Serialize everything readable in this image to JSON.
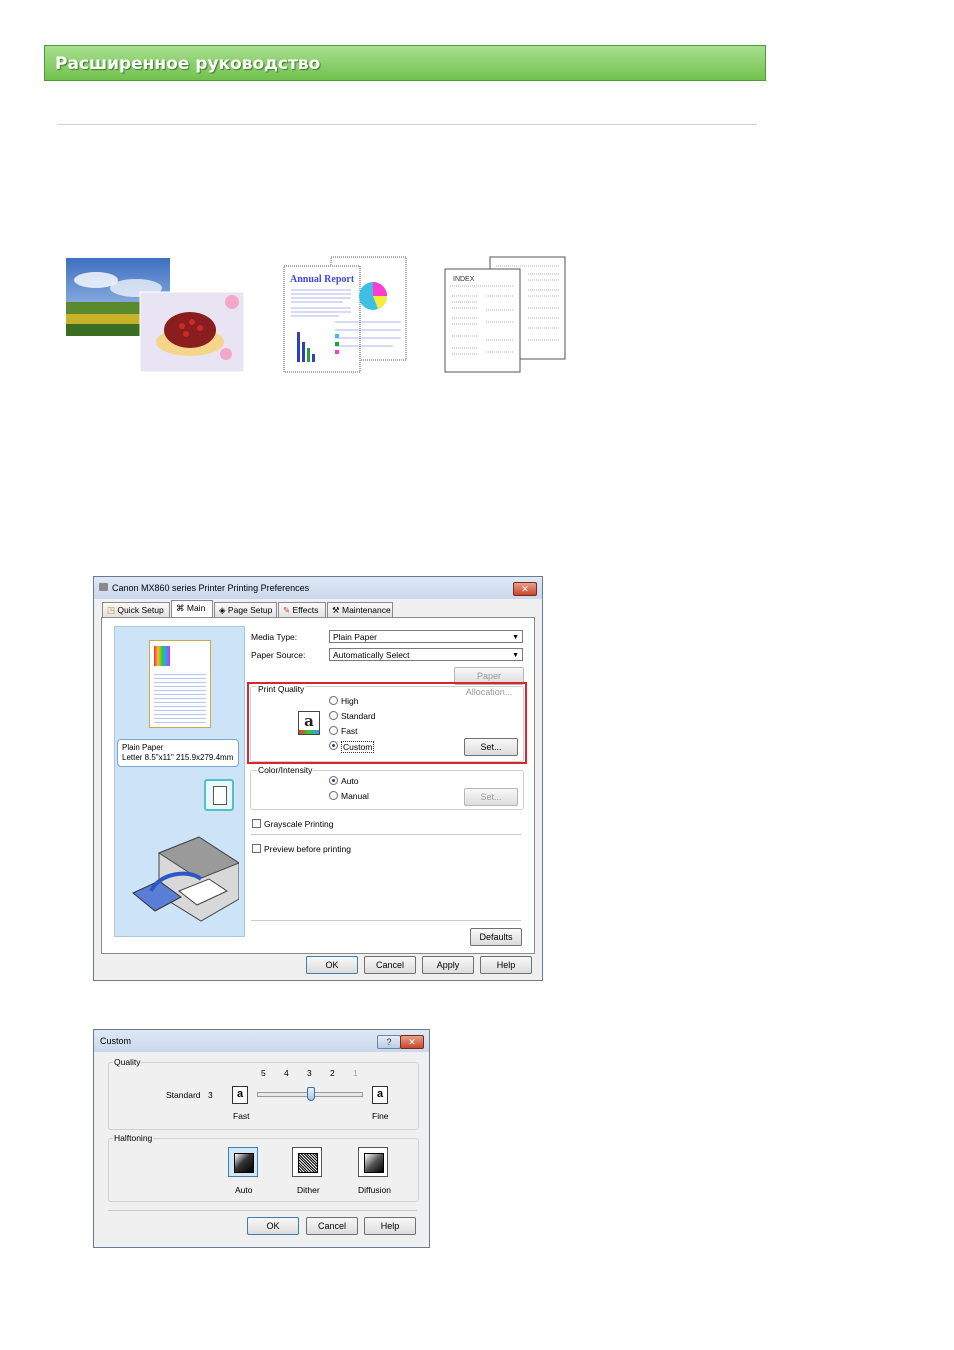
{
  "header": {
    "title": "Расширенное руководство"
  },
  "main_dialog": {
    "title": "Canon MX860 series Printer Printing Preferences",
    "tabs": [
      "Quick Setup",
      "Main",
      "Page Setup",
      "Effects",
      "Maintenance"
    ],
    "media_type_label": "Media Type:",
    "media_type_value": "Plain Paper",
    "paper_source_label": "Paper Source:",
    "paper_source_value": "Automatically Select",
    "paper_allocation": "Paper Allocation...",
    "print_quality_label": "Print Quality",
    "quality_options": [
      "High",
      "Standard",
      "Fast",
      "Custom"
    ],
    "set_label": "Set...",
    "color_intensity_label": "Color/Intensity",
    "color_options": [
      "Auto",
      "Manual"
    ],
    "grayscale_label": "Grayscale Printing",
    "preview_label": "Preview before printing",
    "paper_info_line1": "Plain Paper",
    "paper_info_line2": "Letter 8.5\"x11\" 215.9x279.4mm",
    "defaults_label": "Defaults",
    "ok_label": "OK",
    "cancel_label": "Cancel",
    "apply_label": "Apply",
    "help_label": "Help",
    "highlight_color": "#d9262a"
  },
  "custom_dialog": {
    "title": "Custom",
    "help_icon": "?",
    "quality_label": "Quality",
    "scale_numbers": [
      "5",
      "4",
      "3",
      "2",
      "1"
    ],
    "current_label": "Standard",
    "current_value": "3",
    "slider_level": 3,
    "fast_label": "Fast",
    "fine_label": "Fine",
    "halftoning_label": "Halftoning",
    "halftone_options": [
      "Auto",
      "Dither",
      "Diffusion"
    ],
    "ok_label": "OK",
    "cancel_label": "Cancel",
    "help_label": "Help"
  },
  "illustrations": {
    "report_title": "Annual Report",
    "index_title": "INDEX"
  }
}
